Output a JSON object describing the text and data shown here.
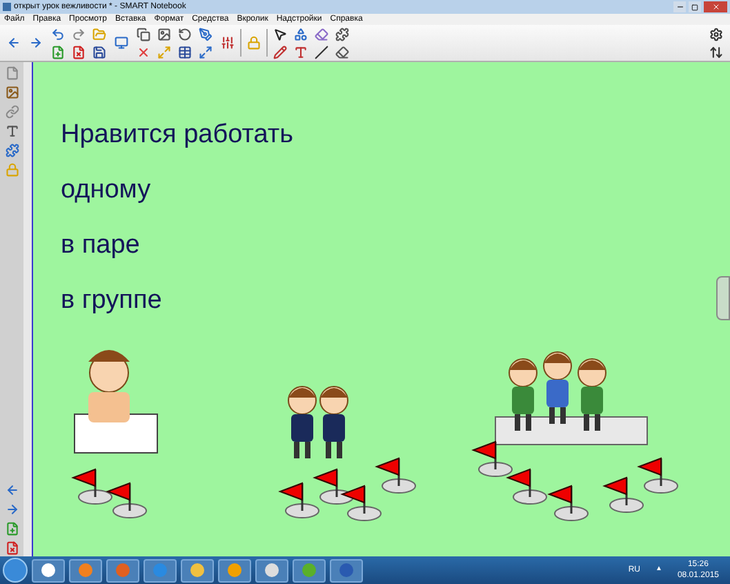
{
  "window": {
    "title": "открыт урок вежливости * - SMART Notebook"
  },
  "menu": [
    "Файл",
    "Правка",
    "Просмотр",
    "Вставка",
    "Формат",
    "Средства",
    "Вкролик",
    "Надстройки",
    "Справка"
  ],
  "canvas": {
    "lines": [
      "Нравится работать",
      "одному",
      "в паре",
      "в группе"
    ]
  },
  "taskbar": {
    "language": "RU",
    "tray_arrow": "▲",
    "time": "15:26",
    "date": "08.01.2015"
  }
}
